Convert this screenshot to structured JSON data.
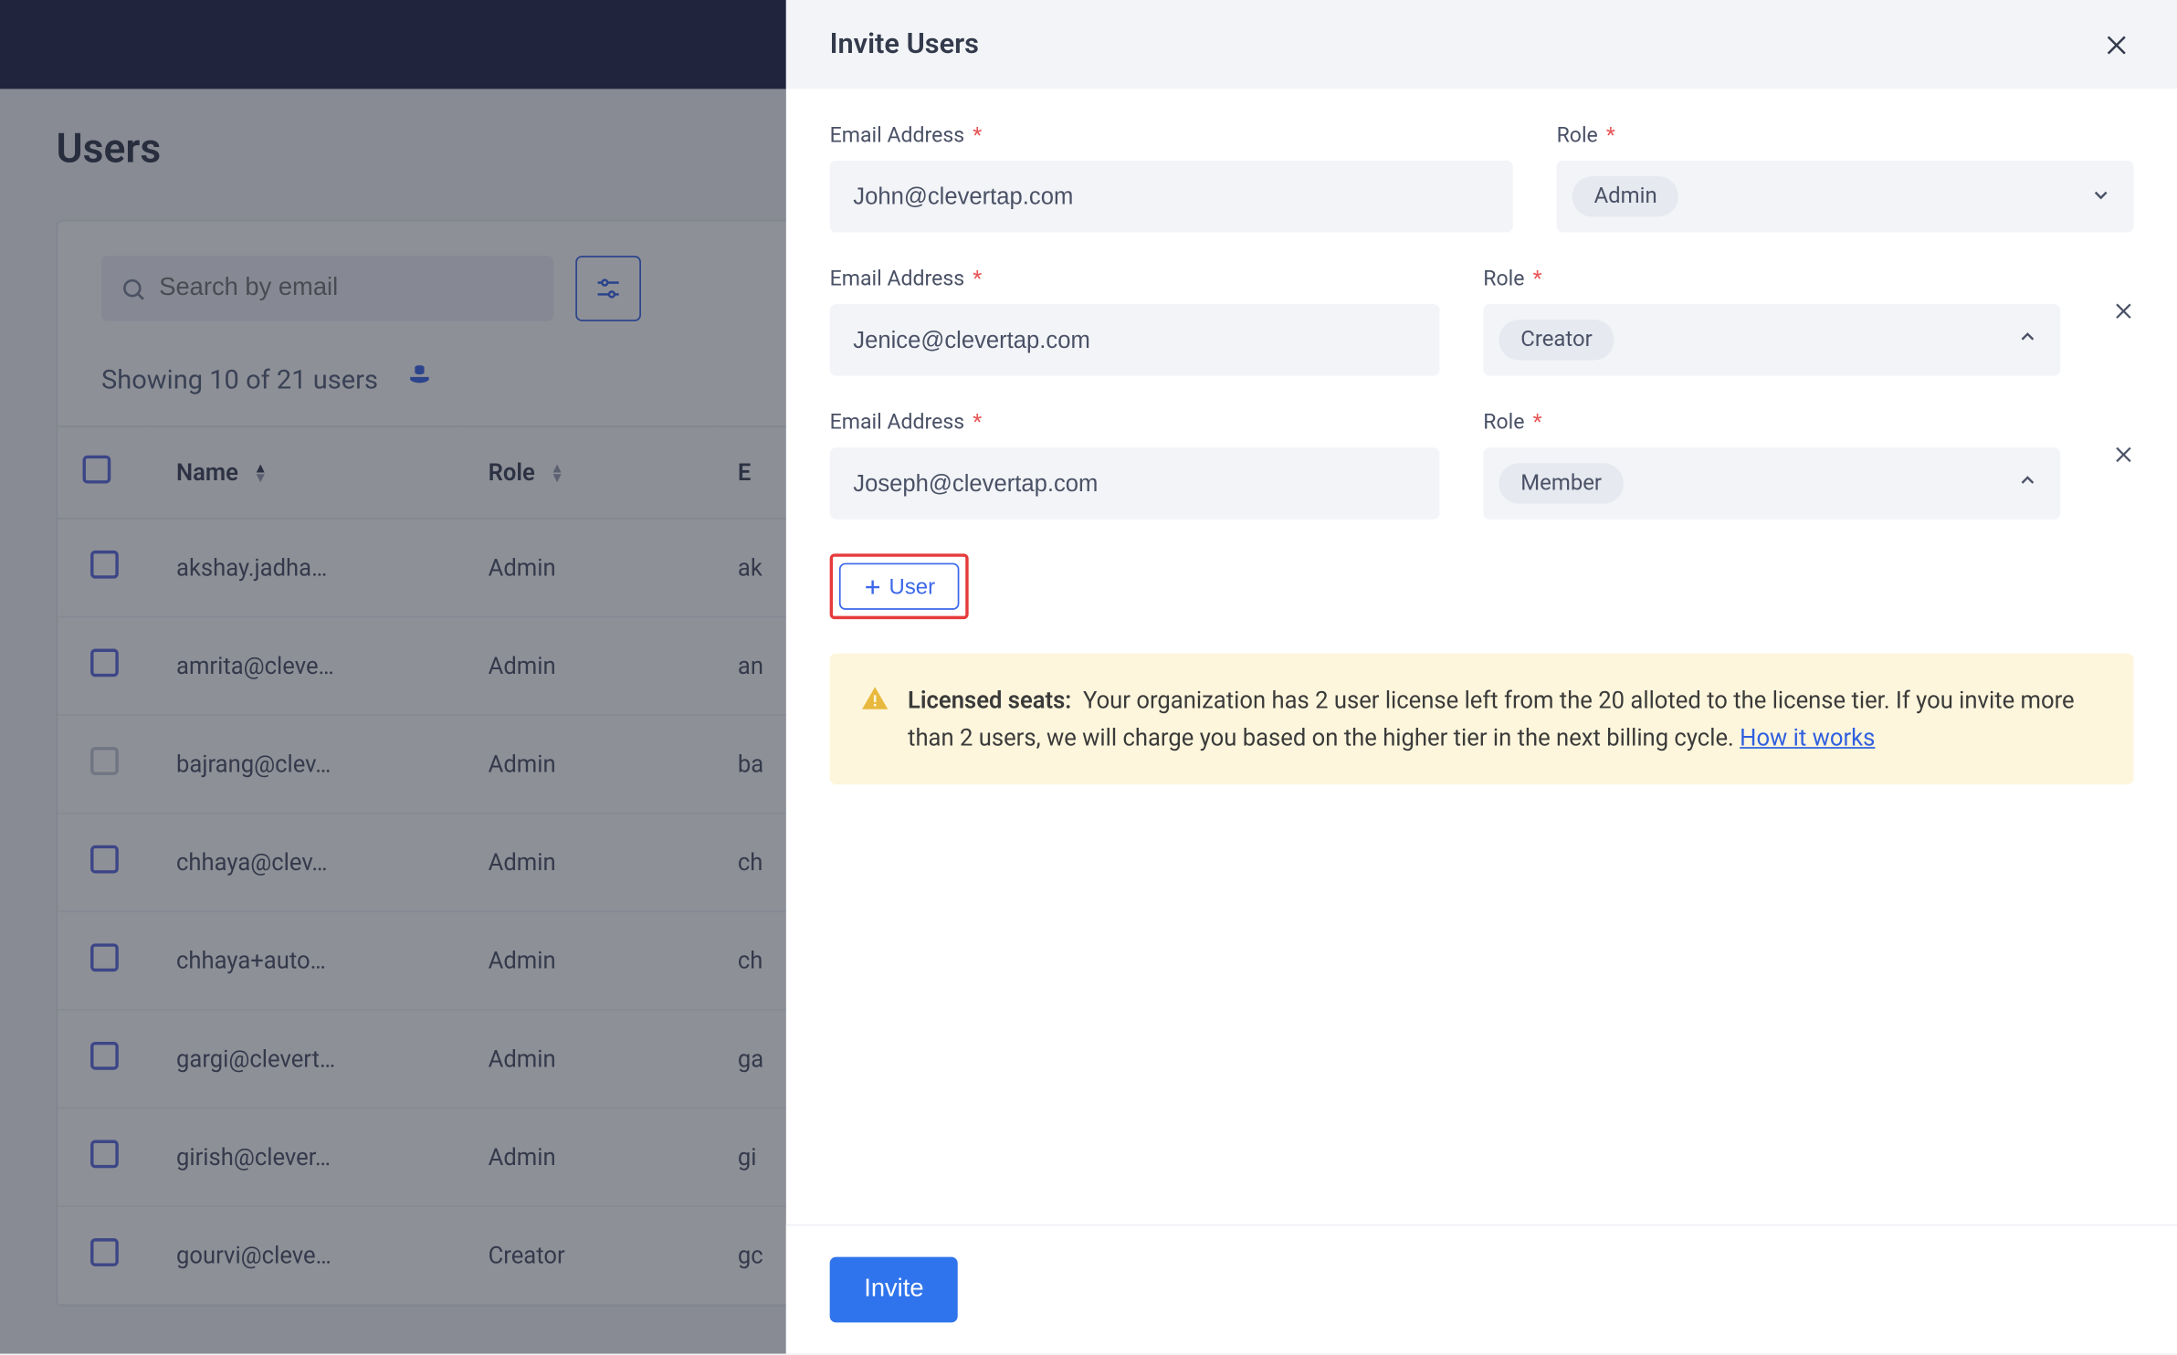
{
  "page": {
    "title": "Users",
    "search_placeholder": "Search by email",
    "showing": "Showing 10 of 21 users"
  },
  "table": {
    "headers": {
      "name": "Name",
      "role": "Role",
      "email": "E"
    },
    "rows": [
      {
        "name": "akshay.jadha…",
        "role": "Admin",
        "email": "ak"
      },
      {
        "name": "amrita@cleve…",
        "role": "Admin",
        "email": "an"
      },
      {
        "name": "bajrang@clev…",
        "role": "Admin",
        "email": "ba"
      },
      {
        "name": "chhaya@clev…",
        "role": "Admin",
        "email": "ch"
      },
      {
        "name": "chhaya+auto…",
        "role": "Admin",
        "email": "ch"
      },
      {
        "name": "gargi@clevert…",
        "role": "Admin",
        "email": "ga"
      },
      {
        "name": "girish@clever…",
        "role": "Admin",
        "email": "gi"
      },
      {
        "name": "gourvi@cleve…",
        "role": "Creator",
        "email": "gc"
      }
    ]
  },
  "drawer": {
    "title": "Invite Users",
    "email_label": "Email Address",
    "role_label": "Role",
    "rows": [
      {
        "email": "John@clevertap.com",
        "role": "Admin",
        "removable": false,
        "caret": "down"
      },
      {
        "email": "Jenice@clevertap.com",
        "role": "Creator",
        "removable": true,
        "caret": "up"
      },
      {
        "email": "Joseph@clevertap.com",
        "role": "Member",
        "removable": true,
        "caret": "up"
      }
    ],
    "add_user": "User",
    "notice": {
      "lead": "Licensed seats:",
      "body": "Your organization has 2 user license left from the 20 alloted to the license tier. If you invite more than 2 users, we will charge you based on the higher tier in the next billing cycle.",
      "link": "How it works"
    },
    "invite_btn": "Invite"
  }
}
